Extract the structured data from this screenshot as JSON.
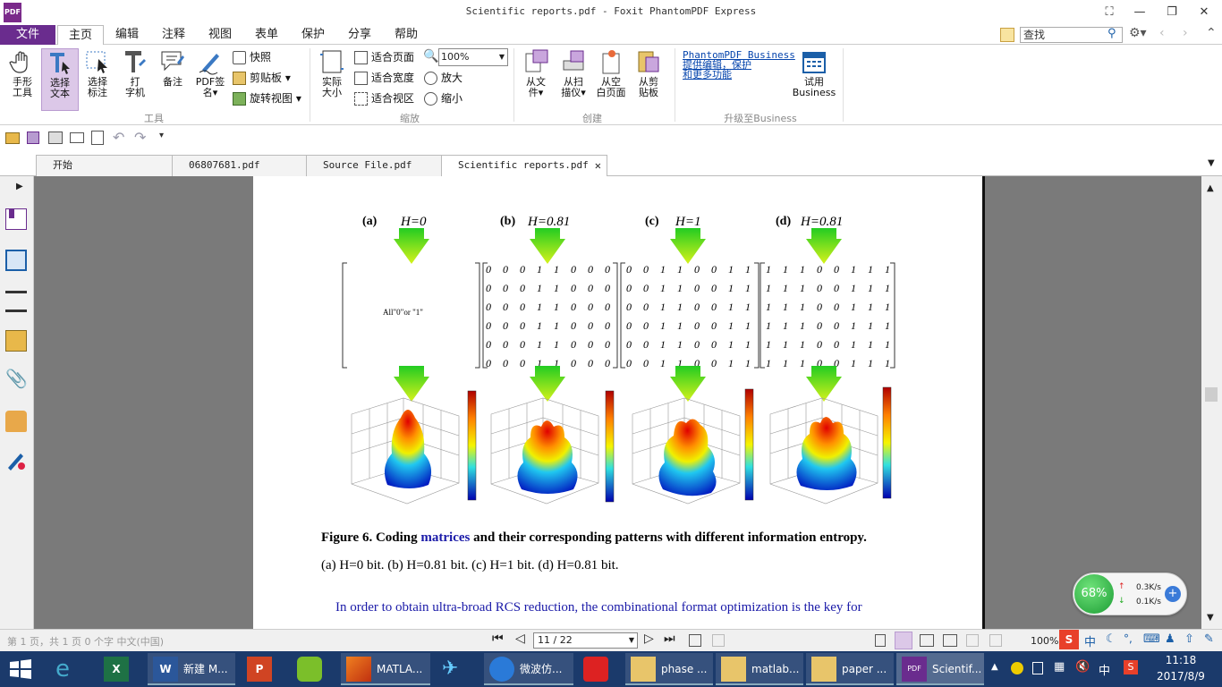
{
  "window": {
    "title": "Scientific reports.pdf - Foxit PhantomPDF Express",
    "logo": "PDF"
  },
  "menu": [
    "文件",
    "主页",
    "编辑",
    "注释",
    "视图",
    "表单",
    "保护",
    "分享",
    "帮助"
  ],
  "search": {
    "placeholder": "查找"
  },
  "ribbon": {
    "tools": {
      "hand": "手形\n工具",
      "select_text": "选择\n文本",
      "select_note": "选择\n标注",
      "typewriter": "打\n字机",
      "note": "备注",
      "pdf_sign": "PDF签\n名▾",
      "snapshot": "快照",
      "clipboard": "剪贴板 ▾",
      "rotate": "旋转视图 ▾",
      "group": "工具"
    },
    "zoom": {
      "actual": "实际\n大小",
      "fit_page": "适合页面",
      "fit_width": "适合宽度",
      "fit_visible": "适合视区",
      "zoom_value": "100%",
      "zoom_in": "放大",
      "zoom_out": "缩小",
      "group": "缩放"
    },
    "create": {
      "from_file": "从文\n件▾",
      "from_scan": "从扫\n描仪▾",
      "from_blank": "从空\n白页面",
      "from_clipboard": "从剪\n贴板",
      "group": "创建"
    },
    "upgrade": {
      "link1": "PhantomPDF Business",
      "link2": "提供编辑，保护",
      "link3": "和更多功能",
      "try": "试用\nBusiness",
      "group": "升级至Business"
    }
  },
  "tabs": [
    {
      "label": "开始"
    },
    {
      "label": "06807681.pdf"
    },
    {
      "label": "Source File.pdf"
    },
    {
      "label": "Scientific reports.pdf"
    }
  ],
  "pdf": {
    "panels": [
      {
        "tag": "(a)",
        "h": "H=0"
      },
      {
        "tag": "(b)",
        "h": "H=0.81"
      },
      {
        "tag": "(c)",
        "h": "H=1"
      },
      {
        "tag": "(d)",
        "h": "H=0.81"
      }
    ],
    "matrix_a_text": "All\"0\"or \"1\"",
    "matrix_b": [
      "0 0 0 1 1 0 0 0",
      "0 0 0 1 1 0 0 0",
      "0 0 0 1 1 0 0 0",
      "0 0 0 1 1 0 0 0",
      "0 0 0 1 1 0 0 0",
      "0 0 0 1 1 0 0 0"
    ],
    "matrix_c": [
      "0 0 1 1 0 0 1 1",
      "0 0 1 1 0 0 1 1",
      "0 0 1 1 0 0 1 1",
      "0 0 1 1 0 0 1 1",
      "0 0 1 1 0 0 1 1",
      "0 0 1 1 0 0 1 1"
    ],
    "matrix_d": [
      "1 1 1 0 0 1 1 1",
      "1 1 1 0 0 1 1 1",
      "1 1 1 0 0 1 1 1",
      "1 1 1 0 0 1 1 1",
      "1 1 1 0 0 1 1 1",
      "1 1 1 0 0 1 1 1"
    ],
    "caption_bold_1": "Figure 6. Coding ",
    "caption_link": "matrices",
    "caption_bold_2": " and their corresponding patterns with different information entropy.",
    "caption_line2": "(a) H=0 bit. (b) H=0.81 bit. (c) H=1 bit. (d) H=0.81 bit.",
    "body_line": "In order to obtain ultra-broad RCS reduction, the combinational format optimization is the key for"
  },
  "status": {
    "page": "11 / 22",
    "zoom": "100%",
    "left_text": "第 1 页，共 1 页    0 个字    中文(中国)"
  },
  "network": {
    "percent": "68%",
    "up": "0.3K/s",
    "down": "0.1K/s"
  },
  "taskbar": {
    "items": [
      {
        "label": ""
      },
      {
        "label": ""
      },
      {
        "label": "新建 M..."
      },
      {
        "label": ""
      },
      {
        "label": ""
      },
      {
        "label": "MATLA..."
      },
      {
        "label": ""
      },
      {
        "label": "微波仿..."
      },
      {
        "label": ""
      },
      {
        "label": "phase ..."
      },
      {
        "label": "matlab..."
      },
      {
        "label": "paper ..."
      },
      {
        "label": "Scientif..."
      }
    ],
    "ime": "中",
    "time": "11:18",
    "date": "2017/8/9"
  },
  "colors": {
    "brand": "#6a2c8e",
    "taskbar": "#1b3a6b",
    "link": "#0645ad",
    "arrow": "#7adf1e"
  }
}
